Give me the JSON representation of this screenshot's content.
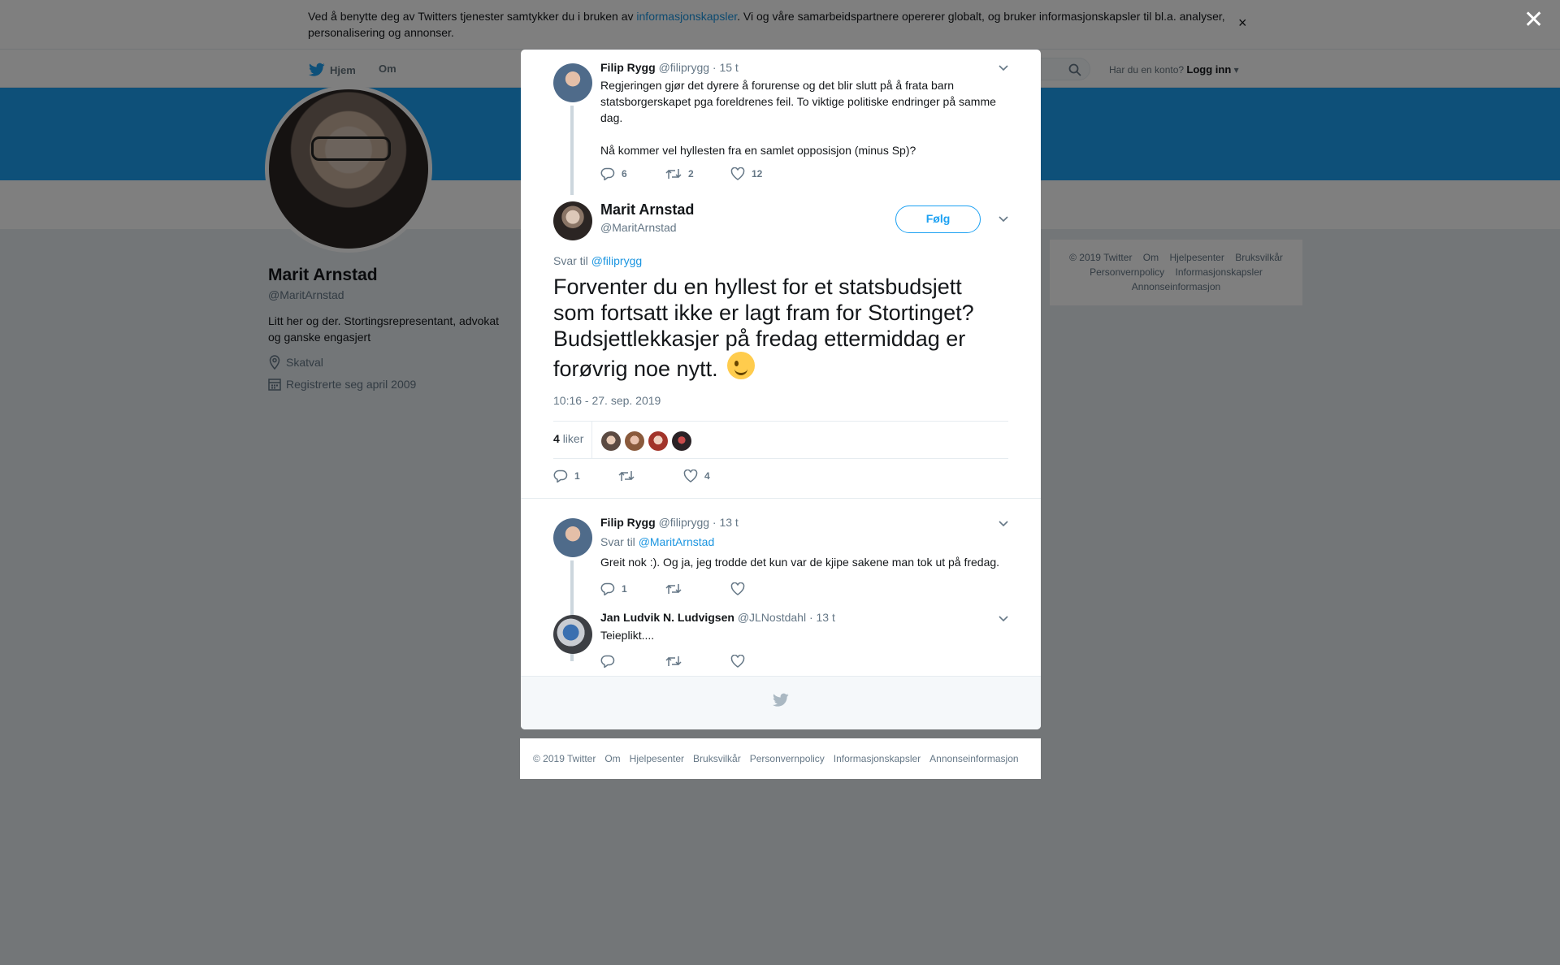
{
  "cookie": {
    "text_before": "Ved å benytte deg av Twitters tjenester samtykker du i bruken av ",
    "link": "informasjonskapsler",
    "text_after": ". Vi og våre samarbeidspartnere opererer globalt, og bruker informasjonskapsler til bl.a. analyser, personalisering og annonser.",
    "close": "×"
  },
  "nav": {
    "home": "Hjem",
    "about": "Om",
    "login_prompt": "Har du en konto?",
    "login": "Logg inn"
  },
  "profile": {
    "name": "Marit Arnstad",
    "handle": "@MaritArnstad",
    "bio": "Litt her og der. Stortingsrepresentant, advokat og ganske engasjert",
    "location": "Skatval",
    "joined": "Registrerte seg april 2009"
  },
  "side_footer": {
    "items": [
      "© 2019 Twitter",
      "Om",
      "Hjelpesenter",
      "Bruksvilkår",
      "Personvernpolicy",
      "Informasjonskapsler",
      "Annonseinformasjon"
    ]
  },
  "overlay": {
    "close": "✕"
  },
  "tweet_parent": {
    "name": "Filip Rygg",
    "handle": "@filiprygg",
    "time": "· 15 t",
    "text_p1": "Regjeringen gjør det dyrere å forurense og det blir slutt på å frata barn statsborgerskapet pga foreldrenes feil. To viktige politiske endringer på samme dag.",
    "text_p2": "Nå kommer vel hyllesten fra en samlet opposisjon (minus Sp)?",
    "replies": "6",
    "retweets": "2",
    "likes": "12"
  },
  "tweet_main": {
    "name": "Marit Arnstad",
    "handle": "@MaritArnstad",
    "follow": "Følg",
    "reply_prefix": "Svar til ",
    "reply_handle": "@filiprygg",
    "text": "Forventer du en hyllest for et statsbudsjett som fortsatt ikke er lagt fram for Stortinget? Budsjettlekkasjer på fredag ettermiddag er forøvrig noe nytt.",
    "emoji": "wink-emoji",
    "timestamp": "10:16 - 27. sep. 2019",
    "likes_count": "4",
    "likes_label": "liker",
    "replies": "1",
    "likes": "4"
  },
  "reply_1": {
    "name": "Filip Rygg",
    "handle": "@filiprygg",
    "time": "· 13 t",
    "reply_prefix": "Svar til ",
    "reply_handle": "@MaritArnstad",
    "text": "Greit nok :). Og ja, jeg trodde det kun var de kjipe sakene man tok ut på fredag.",
    "replies": "1"
  },
  "reply_2": {
    "name": "Jan Ludvik N. Ludvigsen",
    "handle": "@JLNostdahl",
    "time": "· 13 t",
    "text": "Teieplikt...."
  },
  "footer": {
    "items": [
      "© 2019 Twitter",
      "Om",
      "Hjelpesenter",
      "Bruksvilkår",
      "Personvernpolicy",
      "Informasjonskapsler",
      "Annonseinformasjon"
    ]
  },
  "colors": {
    "accent": "#1da1f2",
    "link": "#1b95e0",
    "muted": "#657786"
  },
  "icons": [
    "twitter-bird-icon",
    "search-icon",
    "location-icon",
    "calendar-icon",
    "reply-icon",
    "retweet-icon",
    "heart-icon",
    "chevron-down-icon",
    "close-icon"
  ]
}
